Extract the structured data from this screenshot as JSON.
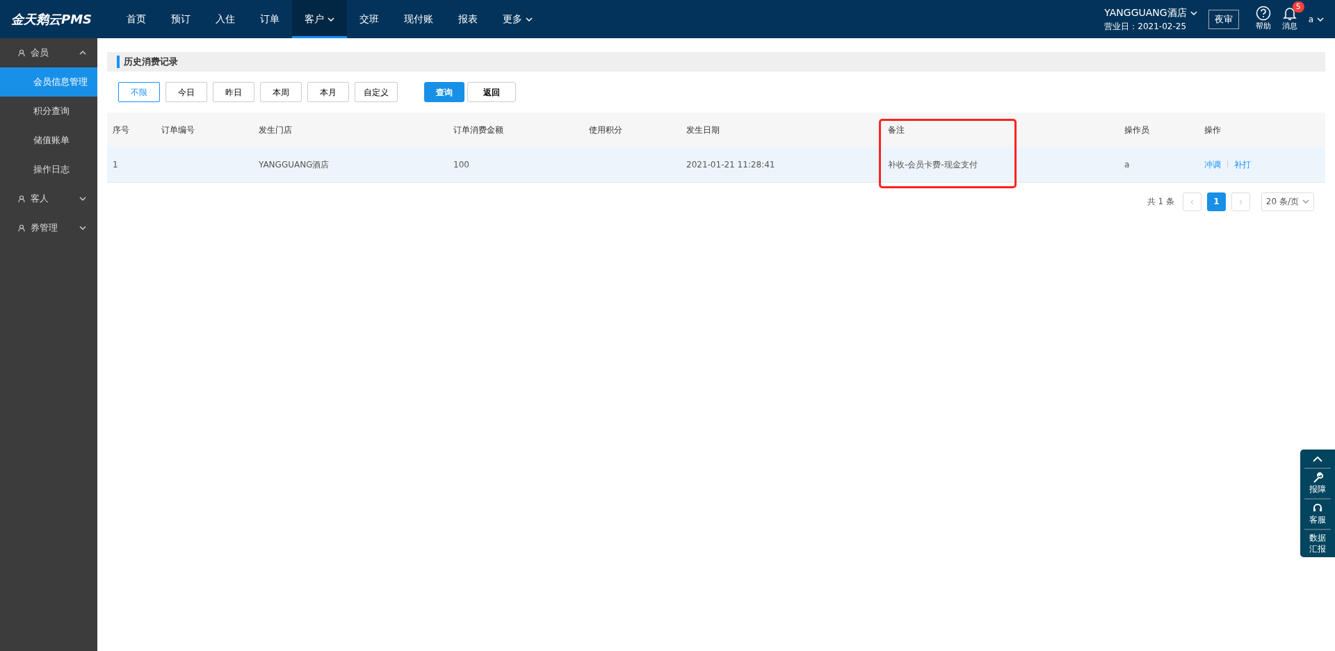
{
  "app": {
    "logo": "金天鹅云PMS"
  },
  "nav": [
    {
      "label": "首页",
      "selected": false,
      "dropdown": false
    },
    {
      "label": "预订",
      "selected": false,
      "dropdown": false
    },
    {
      "label": "入住",
      "selected": false,
      "dropdown": false
    },
    {
      "label": "订单",
      "selected": false,
      "dropdown": false
    },
    {
      "label": "客户",
      "selected": true,
      "dropdown": true
    },
    {
      "label": "交班",
      "selected": false,
      "dropdown": false
    },
    {
      "label": "现付账",
      "selected": false,
      "dropdown": false
    },
    {
      "label": "报表",
      "selected": false,
      "dropdown": false
    },
    {
      "label": "更多",
      "selected": false,
      "dropdown": true
    }
  ],
  "header": {
    "hotel": "YANGGUANG酒店",
    "business_date": "营业日：2021-02-25",
    "night_audit": "夜审",
    "help": "帮助",
    "messages": "消息",
    "message_count": "5",
    "user": "a"
  },
  "sidebar": [
    {
      "label": "会员",
      "expanded": true,
      "children": [
        {
          "label": "会员信息管理",
          "selected": true
        },
        {
          "label": "积分查询",
          "selected": false
        },
        {
          "label": "储值账单",
          "selected": false
        },
        {
          "label": "操作日志",
          "selected": false
        }
      ]
    },
    {
      "label": "客人",
      "expanded": false
    },
    {
      "label": "券管理",
      "expanded": false
    }
  ],
  "page": {
    "title": "历史消费记录"
  },
  "filters": [
    {
      "label": "不限",
      "selected": true
    },
    {
      "label": "今日",
      "selected": false
    },
    {
      "label": "昨日",
      "selected": false
    },
    {
      "label": "本周",
      "selected": false
    },
    {
      "label": "本月",
      "selected": false
    },
    {
      "label": "自定义",
      "selected": false
    }
  ],
  "actions": [
    {
      "label": "查询",
      "kind": "primary"
    },
    {
      "label": "返回",
      "kind": "default"
    }
  ],
  "table": {
    "columns": [
      "序号",
      "订单编号",
      "发生门店",
      "订单消费金额",
      "使用积分",
      "发生日期",
      "备注",
      "操作员",
      "操作"
    ],
    "rows": [
      {
        "cells": [
          "1",
          "",
          "YANGGUANG酒店",
          "100",
          "",
          "2021-01-21 11:28:41",
          "补收-会员卡费-现金支付",
          "a"
        ],
        "links": [
          "冲调",
          "补打"
        ]
      }
    ]
  },
  "pagination": {
    "total": "共 1 条",
    "pages": [
      {
        "label": "1",
        "selected": true
      }
    ],
    "page_size": "20 条/页"
  },
  "float_panel": [
    {
      "label": "报障",
      "kind": "wrench"
    },
    {
      "label": "客服",
      "kind": "headset"
    },
    {
      "label": "数据汇报",
      "kind": "text"
    }
  ]
}
